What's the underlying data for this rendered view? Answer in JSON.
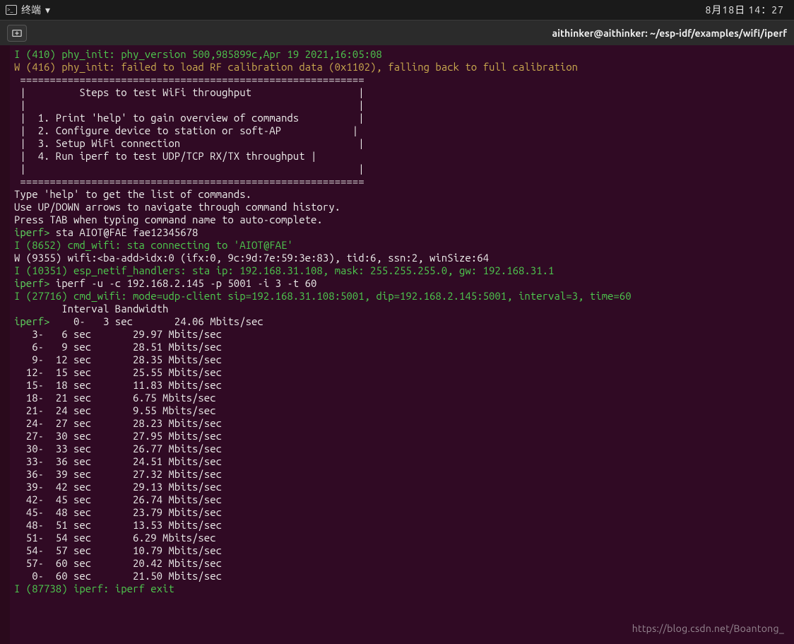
{
  "topbar": {
    "app_label": "终端",
    "dropdown_glyph": "▾",
    "date_time": "8月18日 14：27"
  },
  "titlebar": {
    "title": "aithinker@aithinker: ~/esp-idf/examples/wifi/iperf"
  },
  "log": {
    "l1": "I (410) phy_init: phy_version 500,985899c,Apr 19 2021,16:05:08",
    "l2": "W (416) phy_init: failed to load RF calibration data (0x1102), falling back to full calibration",
    "sep": " ==========================================================",
    "h1": " |         Steps to test WiFi throughput                  |",
    "h2": " |                                                        |",
    "h3": " |  1. Print 'help' to gain overview of commands          |",
    "h4": " |  2. Configure device to station or soft-AP            |",
    "h5": " |  3. Setup WiFi connection                              |",
    "h6": " |  4. Run iperf to test UDP/TCP RX/TX throughput |",
    "h7": " |                                                        |",
    "sep2": " ==========================================================",
    "t1": "Type 'help' to get the list of commands.",
    "t2": "Use UP/DOWN arrows to navigate through command history.",
    "t3": "Press TAB when typing command name to auto-complete.",
    "prompt1_prefix": "iperf>",
    "prompt1_cmd": " sta AIOT@FAE fae12345678",
    "g1": "I (8652) cmd_wifi: sta connecting to 'AIOT@FAE'",
    "w1": "W (9355) wifi:<ba-add>idx:0 (ifx:0, 9c:9d:7e:59:3e:83), tid:6, ssn:2, winSize:64",
    "g2": "I (10351) esp_netif_handlers: sta ip: 192.168.31.108, mask: 255.255.255.0, gw: 192.168.31.1",
    "prompt2_prefix": "iperf>",
    "prompt2_cmd": " iperf -u -c 192.168.2.145 -p 5001 -i 3 -t 60",
    "g3": "I (27716) cmd_wifi: mode=udp-client sip=192.168.31.108:5001, dip=192.168.2.145:5001, interval=3, time=60",
    "hdr": "        Interval Bandwidth",
    "row0_prefix": "iperf>",
    "row0_tail": "    0-   3 sec       24.06 Mbits/sec",
    "rows": [
      "   3-   6 sec       29.97 Mbits/sec",
      "   6-   9 sec       28.51 Mbits/sec",
      "   9-  12 sec       28.35 Mbits/sec",
      "  12-  15 sec       25.55 Mbits/sec",
      "  15-  18 sec       11.83 Mbits/sec",
      "  18-  21 sec       6.75 Mbits/sec",
      "  21-  24 sec       9.55 Mbits/sec",
      "  24-  27 sec       28.23 Mbits/sec",
      "  27-  30 sec       27.95 Mbits/sec",
      "  30-  33 sec       26.77 Mbits/sec",
      "  33-  36 sec       24.51 Mbits/sec",
      "  36-  39 sec       27.32 Mbits/sec",
      "  39-  42 sec       29.13 Mbits/sec",
      "  42-  45 sec       26.74 Mbits/sec",
      "  45-  48 sec       23.79 Mbits/sec",
      "  48-  51 sec       13.53 Mbits/sec",
      "  51-  54 sec       6.29 Mbits/sec",
      "  54-  57 sec       10.79 Mbits/sec",
      "  57-  60 sec       20.42 Mbits/sec",
      "   0-  60 sec       21.50 Mbits/sec"
    ],
    "exit": "I (87738) iperf: iperf exit"
  },
  "watermark": "https://blog.csdn.net/Boantong_"
}
